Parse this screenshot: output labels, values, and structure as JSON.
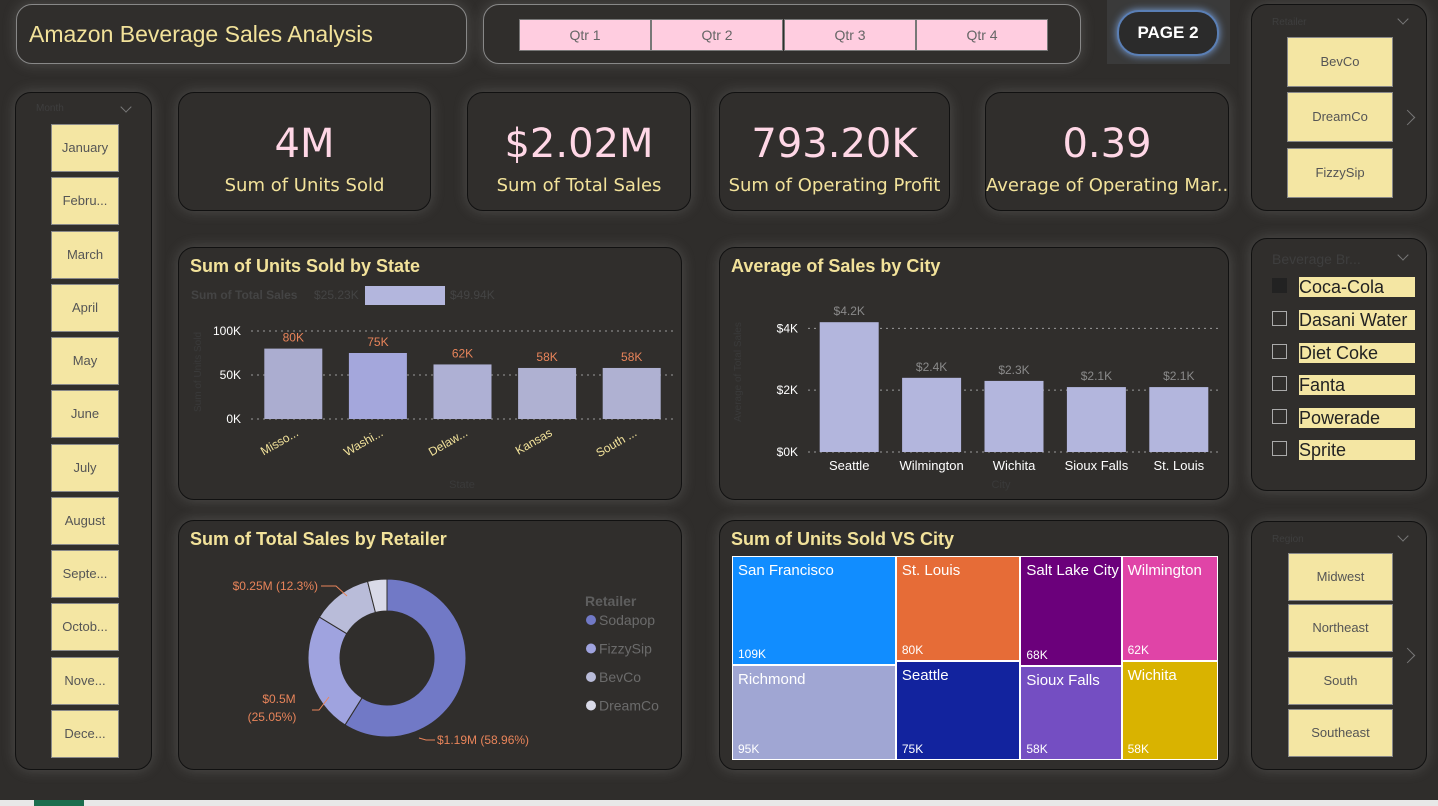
{
  "header": {
    "title": "Amazon Beverage Sales Analysis",
    "page_button": "PAGE 2"
  },
  "quarters": [
    "Qtr 1",
    "Qtr 2",
    "Qtr 3",
    "Qtr 4"
  ],
  "months": {
    "title": "Month",
    "items": [
      "January",
      "Febru...",
      "March",
      "April",
      "May",
      "June",
      "July",
      "August",
      "Septe...",
      "Octob...",
      "Nove...",
      "Dece..."
    ]
  },
  "kpis": [
    {
      "value": "4M",
      "label": "Sum of Units Sold"
    },
    {
      "value": "$2.02M",
      "label": "Sum of Total Sales"
    },
    {
      "value": "793.20K",
      "label": "Sum of Operating Profit"
    },
    {
      "value": "0.39",
      "label": "Average of Operating Mar..."
    }
  ],
  "retailer_slicer": {
    "title": "Retailer",
    "items": [
      "BevCo",
      "DreamCo",
      "FizzySip"
    ]
  },
  "beverage_slicer": {
    "title": "Beverage Br...",
    "items": [
      "Coca-Cola",
      "Dasani Water",
      "Diet Coke",
      "Fanta",
      "Powerade",
      "Sprite"
    ]
  },
  "region_slicer": {
    "title": "Region",
    "items": [
      "Midwest",
      "Northeast",
      "South",
      "Southeast"
    ]
  },
  "colors": {
    "accent": "#f2e29a",
    "kpi": "#ffd7e6",
    "bar": "#b3b6dd",
    "label": "#e8845a"
  },
  "chart_data": [
    {
      "type": "bar",
      "title": "Sum of Units Sold by State",
      "xlabel": "State",
      "ylabel": "Sum of Units Sold",
      "categories": [
        "Misso...",
        "Washi...",
        "Delaw...",
        "Kansas",
        "South ..."
      ],
      "values": [
        80000,
        75000,
        62000,
        58000,
        58000
      ],
      "data_labels": [
        "80K",
        "75K",
        "62K",
        "58K",
        "58K"
      ],
      "color_legend": {
        "title": "Sum of Total Sales",
        "min": "$25.23K",
        "max": "$49.94K"
      },
      "ylim": [
        0,
        100000
      ],
      "yticks": [
        "0K",
        "50K",
        "100K"
      ],
      "grid": true
    },
    {
      "type": "bar",
      "title": "Average of Sales by City",
      "xlabel": "City",
      "ylabel": "Average of Total Sales",
      "categories": [
        "Seattle",
        "Wilmington",
        "Wichita",
        "Sioux Falls",
        "St. Louis"
      ],
      "values": [
        4200,
        2400,
        2300,
        2100,
        2100
      ],
      "data_labels": [
        "$4.2K",
        "$2.4K",
        "$2.3K",
        "$2.1K",
        "$2.1K"
      ],
      "ylim": [
        0,
        4400
      ],
      "yticks": [
        "$0K",
        "$2K",
        "$4K"
      ],
      "grid": true
    },
    {
      "type": "pie",
      "title": "Sum of Total Sales by Retailer",
      "legend_title": "Retailer",
      "labels": [
        "Sodapop",
        "FizzySip",
        "BevCo",
        "DreamCo"
      ],
      "values": [
        1.19,
        0.5,
        0.25,
        0.08
      ],
      "data_labels": [
        "$1.19M (58.96%)",
        "$0.5M (25.05%)",
        "$0.25M (12.3%)",
        ""
      ],
      "colors": [
        "#7179c6",
        "#9fa3df",
        "#b9bcd9",
        "#d9dae8"
      ],
      "legend_position": "right"
    },
    {
      "type": "treemap",
      "title": "Sum of Units Sold VS City",
      "labels": [
        "San Francisco",
        "Richmond",
        "St. Louis",
        "Seattle",
        "Salt Lake City",
        "Sioux Falls",
        "Wilmington",
        "Wichita"
      ],
      "values": [
        109000,
        95000,
        80000,
        75000,
        68000,
        58000,
        62000,
        58000
      ],
      "data_labels": [
        "109K",
        "95K",
        "80K",
        "75K",
        "68K",
        "58K",
        "62K",
        "58K"
      ],
      "colors": [
        "#118dff",
        "#a0a6d3",
        "#e66c37",
        "#12239e",
        "#6b007b",
        "#744ec2",
        "#e044a7",
        "#d9b300"
      ]
    }
  ]
}
